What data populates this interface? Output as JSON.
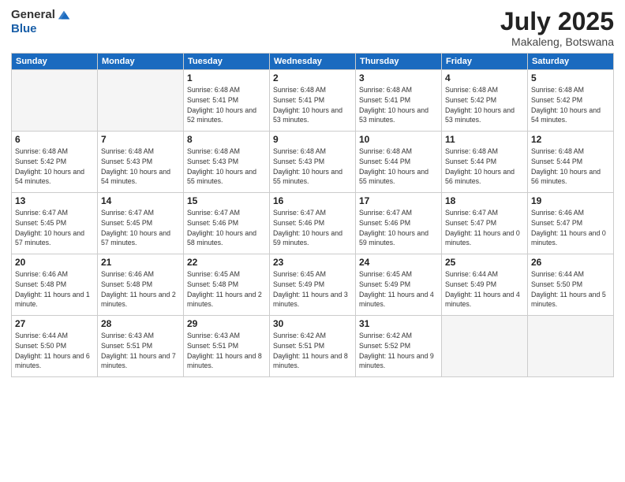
{
  "header": {
    "logo_general": "General",
    "logo_blue": "Blue",
    "month": "July 2025",
    "location": "Makaleng, Botswana"
  },
  "weekdays": [
    "Sunday",
    "Monday",
    "Tuesday",
    "Wednesday",
    "Thursday",
    "Friday",
    "Saturday"
  ],
  "weeks": [
    [
      {
        "day": "",
        "info": ""
      },
      {
        "day": "",
        "info": ""
      },
      {
        "day": "1",
        "info": "Sunrise: 6:48 AM\nSunset: 5:41 PM\nDaylight: 10 hours and 52 minutes."
      },
      {
        "day": "2",
        "info": "Sunrise: 6:48 AM\nSunset: 5:41 PM\nDaylight: 10 hours and 53 minutes."
      },
      {
        "day": "3",
        "info": "Sunrise: 6:48 AM\nSunset: 5:41 PM\nDaylight: 10 hours and 53 minutes."
      },
      {
        "day": "4",
        "info": "Sunrise: 6:48 AM\nSunset: 5:42 PM\nDaylight: 10 hours and 53 minutes."
      },
      {
        "day": "5",
        "info": "Sunrise: 6:48 AM\nSunset: 5:42 PM\nDaylight: 10 hours and 54 minutes."
      }
    ],
    [
      {
        "day": "6",
        "info": "Sunrise: 6:48 AM\nSunset: 5:42 PM\nDaylight: 10 hours and 54 minutes."
      },
      {
        "day": "7",
        "info": "Sunrise: 6:48 AM\nSunset: 5:43 PM\nDaylight: 10 hours and 54 minutes."
      },
      {
        "day": "8",
        "info": "Sunrise: 6:48 AM\nSunset: 5:43 PM\nDaylight: 10 hours and 55 minutes."
      },
      {
        "day": "9",
        "info": "Sunrise: 6:48 AM\nSunset: 5:43 PM\nDaylight: 10 hours and 55 minutes."
      },
      {
        "day": "10",
        "info": "Sunrise: 6:48 AM\nSunset: 5:44 PM\nDaylight: 10 hours and 55 minutes."
      },
      {
        "day": "11",
        "info": "Sunrise: 6:48 AM\nSunset: 5:44 PM\nDaylight: 10 hours and 56 minutes."
      },
      {
        "day": "12",
        "info": "Sunrise: 6:48 AM\nSunset: 5:44 PM\nDaylight: 10 hours and 56 minutes."
      }
    ],
    [
      {
        "day": "13",
        "info": "Sunrise: 6:47 AM\nSunset: 5:45 PM\nDaylight: 10 hours and 57 minutes."
      },
      {
        "day": "14",
        "info": "Sunrise: 6:47 AM\nSunset: 5:45 PM\nDaylight: 10 hours and 57 minutes."
      },
      {
        "day": "15",
        "info": "Sunrise: 6:47 AM\nSunset: 5:46 PM\nDaylight: 10 hours and 58 minutes."
      },
      {
        "day": "16",
        "info": "Sunrise: 6:47 AM\nSunset: 5:46 PM\nDaylight: 10 hours and 59 minutes."
      },
      {
        "day": "17",
        "info": "Sunrise: 6:47 AM\nSunset: 5:46 PM\nDaylight: 10 hours and 59 minutes."
      },
      {
        "day": "18",
        "info": "Sunrise: 6:47 AM\nSunset: 5:47 PM\nDaylight: 11 hours and 0 minutes."
      },
      {
        "day": "19",
        "info": "Sunrise: 6:46 AM\nSunset: 5:47 PM\nDaylight: 11 hours and 0 minutes."
      }
    ],
    [
      {
        "day": "20",
        "info": "Sunrise: 6:46 AM\nSunset: 5:48 PM\nDaylight: 11 hours and 1 minute."
      },
      {
        "day": "21",
        "info": "Sunrise: 6:46 AM\nSunset: 5:48 PM\nDaylight: 11 hours and 2 minutes."
      },
      {
        "day": "22",
        "info": "Sunrise: 6:45 AM\nSunset: 5:48 PM\nDaylight: 11 hours and 2 minutes."
      },
      {
        "day": "23",
        "info": "Sunrise: 6:45 AM\nSunset: 5:49 PM\nDaylight: 11 hours and 3 minutes."
      },
      {
        "day": "24",
        "info": "Sunrise: 6:45 AM\nSunset: 5:49 PM\nDaylight: 11 hours and 4 minutes."
      },
      {
        "day": "25",
        "info": "Sunrise: 6:44 AM\nSunset: 5:49 PM\nDaylight: 11 hours and 4 minutes."
      },
      {
        "day": "26",
        "info": "Sunrise: 6:44 AM\nSunset: 5:50 PM\nDaylight: 11 hours and 5 minutes."
      }
    ],
    [
      {
        "day": "27",
        "info": "Sunrise: 6:44 AM\nSunset: 5:50 PM\nDaylight: 11 hours and 6 minutes."
      },
      {
        "day": "28",
        "info": "Sunrise: 6:43 AM\nSunset: 5:51 PM\nDaylight: 11 hours and 7 minutes."
      },
      {
        "day": "29",
        "info": "Sunrise: 6:43 AM\nSunset: 5:51 PM\nDaylight: 11 hours and 8 minutes."
      },
      {
        "day": "30",
        "info": "Sunrise: 6:42 AM\nSunset: 5:51 PM\nDaylight: 11 hours and 8 minutes."
      },
      {
        "day": "31",
        "info": "Sunrise: 6:42 AM\nSunset: 5:52 PM\nDaylight: 11 hours and 9 minutes."
      },
      {
        "day": "",
        "info": ""
      },
      {
        "day": "",
        "info": ""
      }
    ]
  ]
}
